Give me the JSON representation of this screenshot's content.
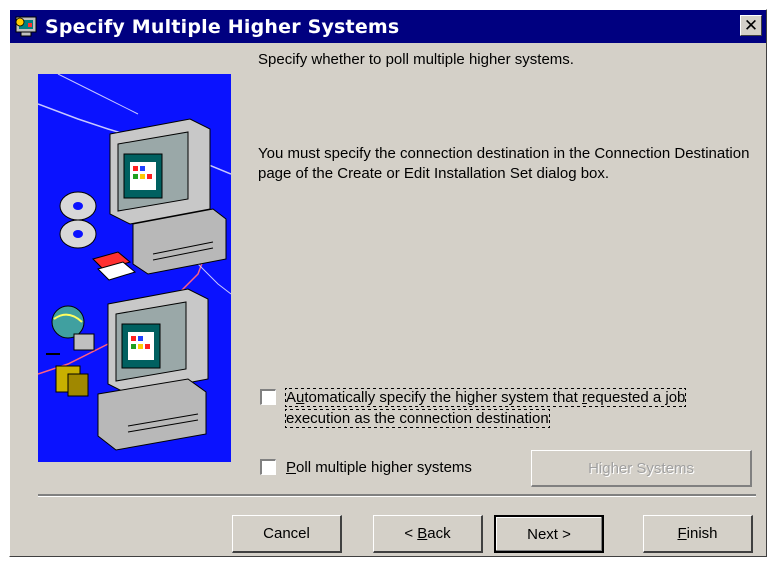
{
  "window": {
    "title": "Specify Multiple Higher Systems",
    "close_glyph": "✕",
    "title_icon": "installer-computer-icon"
  },
  "header_text": "Specify whether to poll multiple higher systems.",
  "info_text": "You must specify the connection destination in the Connection Destination page of the Create or Edit Installation Set dialog box.",
  "illustration": {
    "name": "networked-computers-illustration",
    "background_color": "#0a12ff"
  },
  "options": {
    "auto_specify": {
      "checked": false,
      "label_pre": "A",
      "label_accel": "u",
      "label_mid": "tomatically specify the higher system that ",
      "label_accel2": "r",
      "label_post": "equested a job execution as the connection destination"
    },
    "poll_multiple": {
      "checked": false,
      "label_accel": "P",
      "label_post": "oll multiple higher systems"
    }
  },
  "higher_systems_button": {
    "label_pre": "Hi",
    "label_accel": "g",
    "label_post": "her Systems",
    "enabled": false
  },
  "buttons": {
    "cancel": "Cancel",
    "back_pre": "< ",
    "back_accel": "B",
    "back_post": "ack",
    "next": "Next >",
    "finish_accel": "F",
    "finish_post": "inish"
  },
  "colors": {
    "title_bar": "#000080",
    "dialog_bg": "#d4d0c8",
    "illustration_bg": "#0a12ff"
  }
}
